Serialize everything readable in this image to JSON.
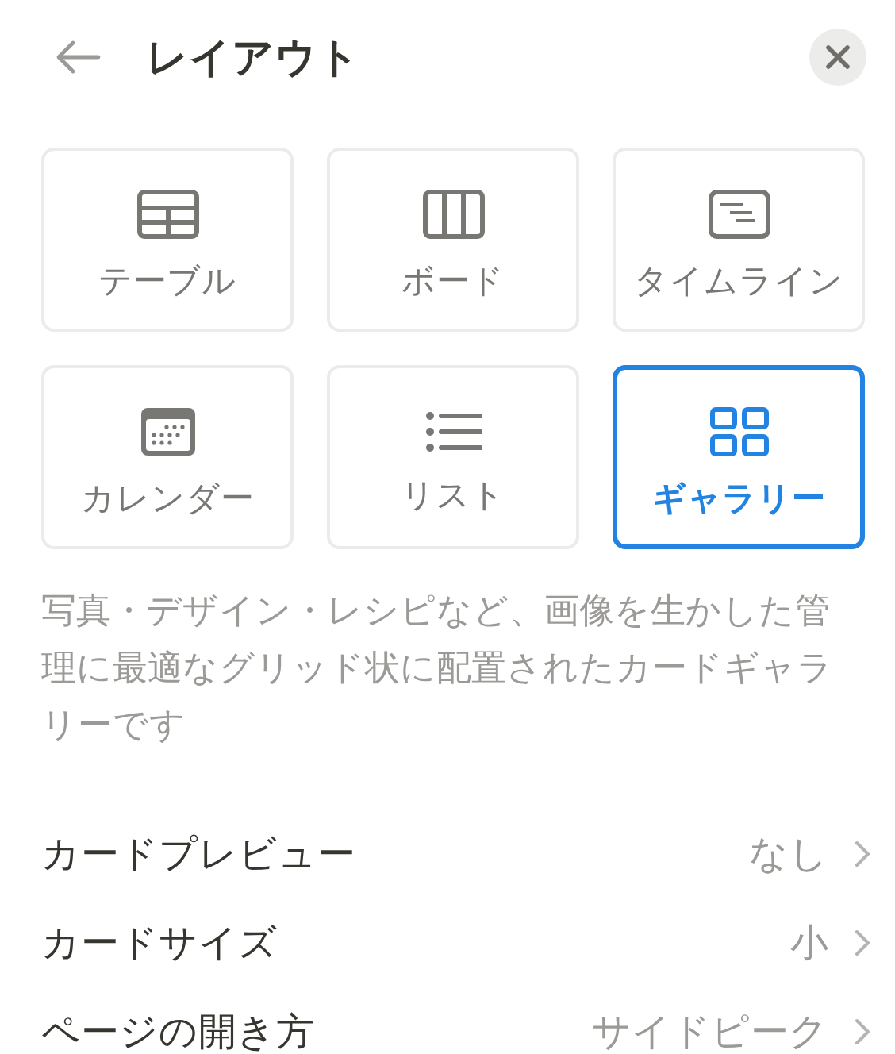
{
  "header": {
    "title": "レイアウト"
  },
  "layouts": [
    {
      "kind": "table",
      "label": "テーブル",
      "selected": false
    },
    {
      "kind": "board",
      "label": "ボード",
      "selected": false
    },
    {
      "kind": "timeline",
      "label": "タイムライン",
      "selected": false
    },
    {
      "kind": "calendar",
      "label": "カレンダー",
      "selected": false
    },
    {
      "kind": "list",
      "label": "リスト",
      "selected": false
    },
    {
      "kind": "gallery",
      "label": "ギャラリー",
      "selected": true
    }
  ],
  "description": "写真・デザイン・レシピなど、画像を生かした管理に最適なグリッド状に配置されたカードギャラリーです",
  "settings": [
    {
      "label": "カードプレビュー",
      "value": "なし"
    },
    {
      "label": "カードサイズ",
      "value": "小"
    },
    {
      "label": "ページの開き方",
      "value": "サイドピーク"
    }
  ]
}
